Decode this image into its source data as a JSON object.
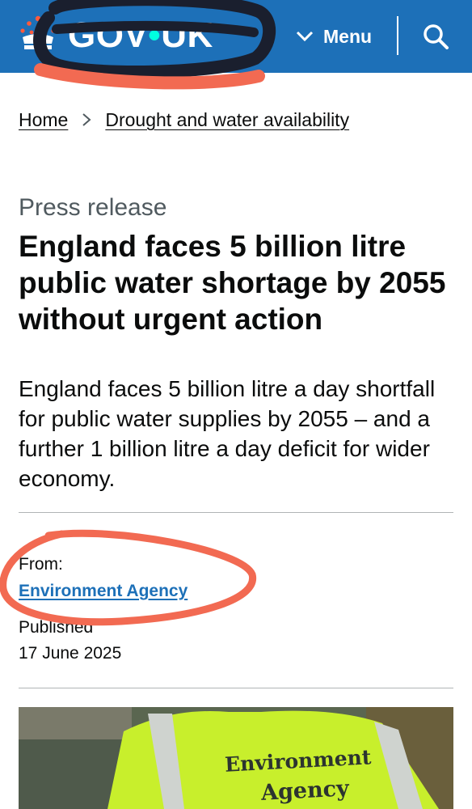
{
  "header": {
    "logo_main": "GOV",
    "logo_dot": "•",
    "logo_end": "UK",
    "menu_label": "Menu",
    "colors": {
      "background": "#1d70b8",
      "text": "#ffffff",
      "dot": "#00ffe0"
    },
    "icons": [
      "crown-icon",
      "chevron-down-icon",
      "search-icon"
    ]
  },
  "breadcrumb": {
    "items": [
      {
        "label": "Home"
      },
      {
        "label": "Drought and water availability"
      }
    ]
  },
  "article": {
    "caption": "Press release",
    "title": "England faces 5 billion litre public water shortage by 2055 without urgent action",
    "lead": "England faces 5 billion litre a day shortfall for public water supplies by 2055 – and a further 1 billion litre a day deficit for wider economy."
  },
  "metadata": {
    "from_label": "From:",
    "from_link": "Environment Agency",
    "published_label": "Published",
    "published_date": "17 June 2025"
  },
  "image": {
    "vest_text_line1": "Environment",
    "vest_text_line2": "Agency",
    "colors": {
      "vest": "#c8ef2c",
      "reflective": "#cfd3cf"
    }
  },
  "annotations": {
    "blue_scribble_color": "#1a1f2e",
    "red_underline_color": "#f26a52",
    "red_circle_color": "#f26a52"
  }
}
